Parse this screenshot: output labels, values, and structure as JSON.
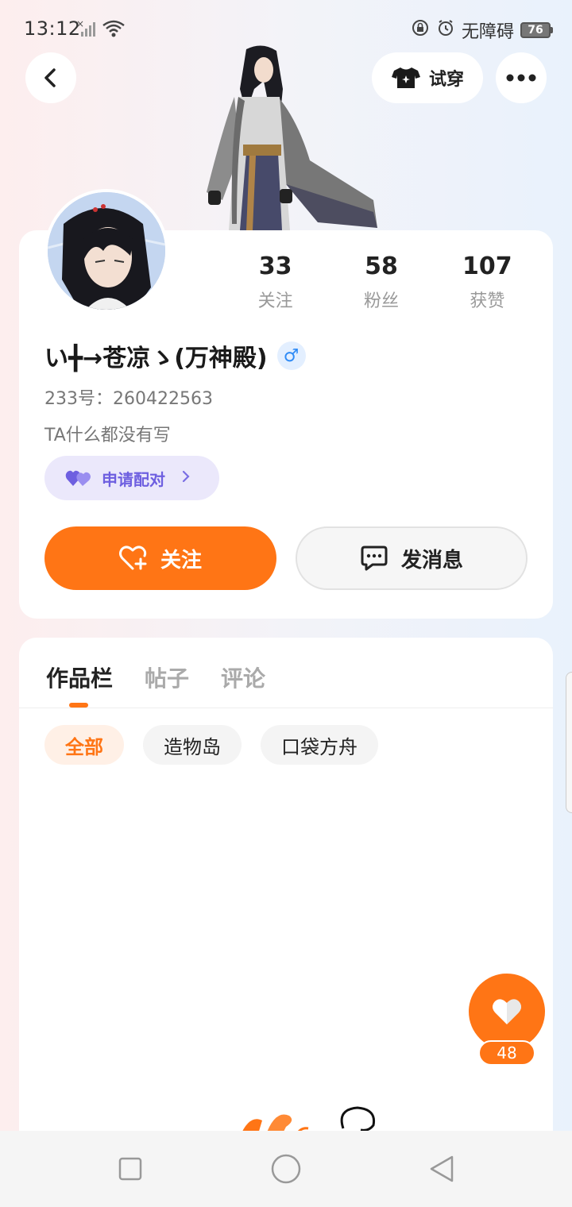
{
  "status_bar": {
    "time": "13:12",
    "accessibility": "无障碍",
    "battery": "76"
  },
  "header": {
    "tryon_label": "试穿"
  },
  "profile": {
    "stats": [
      {
        "value": "33",
        "label": "关注"
      },
      {
        "value": "58",
        "label": "粉丝"
      },
      {
        "value": "107",
        "label": "获赞"
      }
    ],
    "username": "い╋→苍凉ゝ(万神殿)",
    "gender_symbol": "♂",
    "uid": "233号：260422563",
    "bio": "TA什么都没有写",
    "pair_label": "申请配对",
    "follow_label": "关注",
    "message_label": "发消息"
  },
  "content": {
    "tabs": [
      "作品栏",
      "帖子",
      "评论"
    ],
    "chips": [
      "全部",
      "造物岛",
      "口袋方舟"
    ]
  },
  "floating": {
    "like_count": "48"
  },
  "colors": {
    "accent": "#ff7515",
    "pair": "#6e5fe0",
    "male": "#2f8bf6"
  }
}
